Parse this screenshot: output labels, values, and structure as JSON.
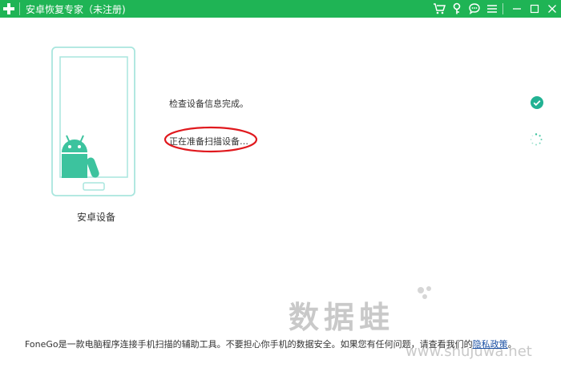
{
  "window": {
    "title": "安卓恢复专家（未注册)"
  },
  "toolbar": {
    "icons": [
      "cart-icon",
      "key-icon",
      "chat-icon",
      "menu-icon"
    ],
    "window_controls": [
      "minimize-icon",
      "maximize-icon",
      "close-icon"
    ]
  },
  "device": {
    "label": "安卓设备"
  },
  "steps": [
    {
      "text": "检查设备信息完成。",
      "status": "done"
    },
    {
      "text": "正在准备扫描设备…",
      "status": "loading"
    }
  ],
  "watermark": {
    "text": "数据蛙",
    "url": "www.shujuwa.net"
  },
  "footer": {
    "text": "FoneGo是一款电脑程序连接手机扫描的辅助工具。不要担心你手机的数据安全。如果您有任何问题，请查看我们的",
    "link": "隐私政策",
    "suffix": "。"
  },
  "colors": {
    "brand_green": "#1fb455",
    "android_green": "#3cc39e",
    "phone_outline": "#a9e6de",
    "highlight_red": "#e0191e"
  }
}
